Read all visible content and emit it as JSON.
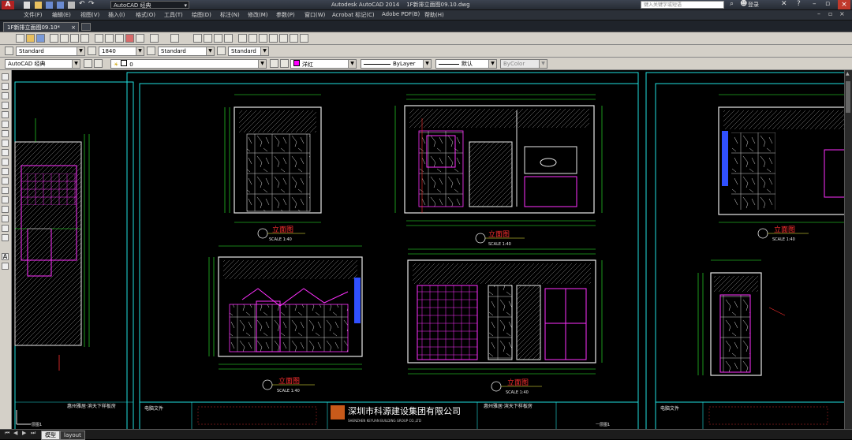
{
  "titlebar": {
    "quick_access_workspace": "AutoCAD 经典",
    "app_title": "Autodesk AutoCAD 2014",
    "file_title": "1F新排立面图09.10.dwg",
    "search_placeholder": "键入关键字或短语",
    "login_label": "登录"
  },
  "menubar": {
    "items": [
      "文件(F)",
      "编辑(E)",
      "视图(V)",
      "插入(I)",
      "格式(O)",
      "工具(T)",
      "绘图(D)",
      "标注(N)",
      "修改(M)",
      "参数(P)",
      "窗口(W)",
      "Acrobat 标记(C)",
      "Adobe PDF(B)",
      "帮助(H)"
    ]
  },
  "file_tabs": {
    "active_tab": "1F新排立面图09.10*"
  },
  "toolbar_styles": {
    "text_style": "Standard",
    "dim_style": "1840",
    "table_style": "Standard",
    "multileader_style": "Standard"
  },
  "toolbar_layers": {
    "workspace": "AutoCAD 经典",
    "layer": "0",
    "color": "洋红",
    "linetype": "ByLayer",
    "lineweight": "默认",
    "plotstyle": "ByColor"
  },
  "drawing": {
    "elevation_titles": [
      "立面图",
      "立面图",
      "立面图",
      "立面图",
      "立面图"
    ],
    "scale_labels": [
      "SCALE 1:40",
      "SCALE 1:40",
      "SCALE 1:40",
      "SCALE 1:40",
      "SCALE 1:40"
    ],
    "company_name": "深圳市科源建设集团有限公司",
    "company_name_en": "SHENZHEN KEYUAN BUILDING GROUP CO.,LTD",
    "project_name": "惠州雅居·滨天下样板房",
    "project_name_2": "惠州雅居·滨天下样板房",
    "electronic_file": "电脑文件",
    "electronic_file_2": "电脑文件",
    "page_label": "一层图1",
    "page_label_2": "一层图1"
  },
  "layout_tabs": {
    "tabs": [
      "模型",
      "layout"
    ]
  },
  "colors": {
    "frame": "#20e0e0",
    "wall": "#e8e8e8",
    "dimension": "#30ff30",
    "furniture": "#ff30ff",
    "title_red": "#ff3030",
    "blue": "#3050ff",
    "yellow": "#ffff40"
  }
}
